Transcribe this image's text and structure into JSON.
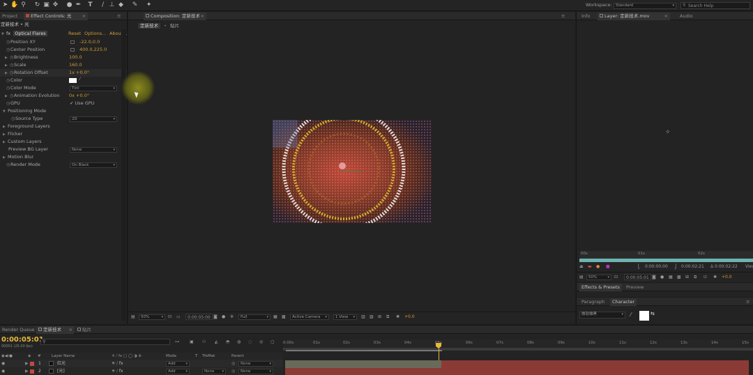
{
  "toolbar": {
    "workspace_label": "Workspace:",
    "workspace_value": "Standard",
    "search_placeholder": "Search Help"
  },
  "left_panel": {
    "tabs": [
      "Project",
      "Effect Controls: 光"
    ],
    "breadcrumb": "定新技术 • 光",
    "effect_name": "Optical Flares",
    "reset": "Reset",
    "options": "Options...",
    "about": "About...",
    "properties": [
      {
        "label": "Position XY",
        "value": "-22.0,0.0"
      },
      {
        "label": "Center Position",
        "value": "400.0,225.0"
      },
      {
        "label": "Brightness",
        "value": "100.0"
      },
      {
        "label": "Scale",
        "value": "160.0"
      },
      {
        "label": "Rotation Offset",
        "value": "1x +0.0°"
      },
      {
        "label": "Color",
        "value": ""
      },
      {
        "label": "Color Mode",
        "value": "Tint"
      },
      {
        "label": "Animation Evolution",
        "value": "0x +0.0°"
      },
      {
        "label": "GPU",
        "value": "Use GPU"
      },
      {
        "label": "Positioning Mode",
        "value": ""
      },
      {
        "label": "Source Type",
        "value": "2D"
      },
      {
        "label": "Foreground Layers",
        "value": ""
      },
      {
        "label": "Flicker",
        "value": ""
      },
      {
        "label": "Custom Layers",
        "value": ""
      },
      {
        "label": "Preview BG Layer",
        "value": "None"
      },
      {
        "label": "Motion Blur",
        "value": ""
      },
      {
        "label": "Render Mode",
        "value": "On Black"
      }
    ]
  },
  "comp_panel": {
    "tab": "Composition: 定新技术",
    "breadcrumbs": [
      "定新技术",
      "贴片"
    ],
    "zoom": "50%",
    "timecode": "0:00:05:00",
    "resolution": "Full",
    "camera": "Active Camera",
    "view": "1 View",
    "exposure": "+0.0"
  },
  "right_panel": {
    "tabs": [
      "Info",
      "Layer: 定新技术.mov",
      "Audio"
    ],
    "ruler": [
      "00s",
      "01s",
      "02s"
    ],
    "in_time": "0:00:00:00",
    "out_time": "0:00:02:21",
    "duration": "Δ 0:00:02:22",
    "view_label": "View",
    "zoom": "50%",
    "timecode": "0:00:05:01",
    "exposure": "+0.0",
    "effects_tabs": [
      "Effects & Presets",
      "Preview"
    ],
    "char_tabs": [
      "Paragraph",
      "Character"
    ],
    "font": "微软雅黑"
  },
  "timeline": {
    "tabs": [
      "Render Queue",
      "定新技术",
      "贴片"
    ],
    "timecode": "0:00:05:01",
    "fps": "00001 (25.00 fps)",
    "columns": [
      "Layer Name",
      "Mode",
      "T",
      "TrkMat",
      "Parent"
    ],
    "ruler": [
      "0:00s",
      "01s",
      "02s",
      "03s",
      "04s",
      "05s",
      "06s",
      "07s",
      "08s",
      "09s",
      "10s",
      "11s",
      "12s",
      "13s",
      "14s",
      "15s"
    ],
    "layers": [
      {
        "num": "1",
        "name": "红光",
        "mode": "Add",
        "trkmat": "",
        "parent": "None"
      },
      {
        "num": "2",
        "name": "[光]",
        "mode": "Add",
        "trkmat": "None",
        "parent": "None"
      }
    ]
  }
}
